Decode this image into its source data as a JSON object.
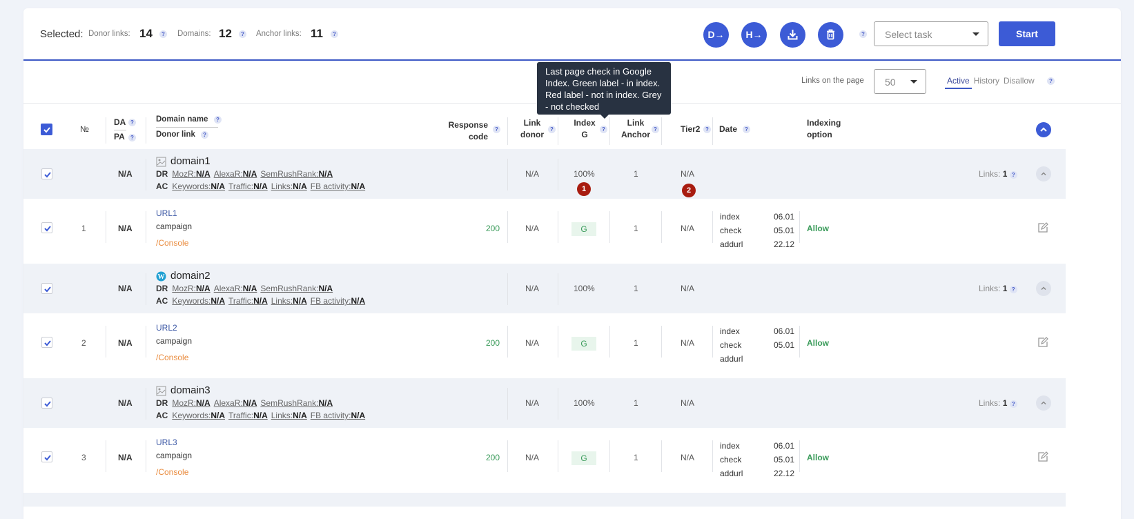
{
  "toolbar": {
    "selected_label": "Selected:",
    "stats": [
      {
        "label": "Donor links:",
        "value": "14"
      },
      {
        "label": "Domains:",
        "value": "12"
      },
      {
        "label": "Anchor links:",
        "value": "11"
      }
    ],
    "action_buttons": [
      {
        "name": "donor-export",
        "glyph": "D→"
      },
      {
        "name": "host-export",
        "glyph": "H→"
      },
      {
        "name": "download",
        "glyph": "download-icon"
      },
      {
        "name": "delete",
        "glyph": "trash-icon"
      }
    ],
    "task_select_placeholder": "Select task",
    "start_label": "Start"
  },
  "subbar": {
    "links_on_page_label": "Links on the page",
    "links_on_page_value": "50",
    "tabs": [
      {
        "label": "Active",
        "active": true
      },
      {
        "label": "History",
        "active": false
      },
      {
        "label": "Disallow",
        "active": false
      }
    ]
  },
  "tooltip": {
    "text": "Last page check in Google Index. Green label - in index. Red label - not in index. Grey - not checked"
  },
  "columns": {
    "num": "№",
    "da": "DA",
    "pa": "PA",
    "domain_name": "Domain name",
    "donor_link": "Donor link",
    "response_code_1": "Response",
    "response_code_2": "code",
    "link_donor_1": "Link",
    "link_donor_2": "donor",
    "index_g_1": "Index",
    "index_g_2": "G",
    "link_anchor_1": "Link",
    "link_anchor_2": "Anchor",
    "tier2": "Tier2",
    "date": "Date",
    "indexing_option_1": "Indexing",
    "indexing_option_2": "option"
  },
  "groups": [
    {
      "domain": "domain1",
      "favicon": "image-placeholder-icon",
      "da": "N/A",
      "dr_key": "DR",
      "ac_key": "AC",
      "dr_metrics": [
        {
          "label": "MozR:",
          "value": "N/A"
        },
        {
          "label": "AlexaR:",
          "value": "N/A"
        },
        {
          "label": "SemRushRank:",
          "value": "N/A"
        }
      ],
      "ac_metrics": [
        {
          "label": "Keywords:",
          "value": "N/A"
        },
        {
          "label": "Traffic:",
          "value": "N/A"
        },
        {
          "label": "Links:",
          "value": "N/A"
        },
        {
          "label": "FB activity:",
          "value": "N/A"
        }
      ],
      "link_donor": "N/A",
      "index_g": "100%",
      "link_anchor": "1",
      "tier2": "N/A",
      "links_label": "Links:",
      "links_count": "1",
      "badges": {
        "index": "1",
        "tier2": "2"
      },
      "link": {
        "num": "1",
        "pa": "N/A",
        "url": "URL1",
        "campaign": "campaign",
        "console": "/Console",
        "response_code": "200",
        "link_donor": "N/A",
        "index_g": "G",
        "link_anchor": "1",
        "tier2": "N/A",
        "dates": [
          {
            "label": "index",
            "value": "06.01"
          },
          {
            "label": "check",
            "value": "05.01"
          },
          {
            "label": "addurl",
            "value": "22.12"
          }
        ],
        "indexing_option": "Allow"
      }
    },
    {
      "domain": "domain2",
      "favicon": "wordpress-icon",
      "da": "N/A",
      "dr_key": "DR",
      "ac_key": "AC",
      "dr_metrics": [
        {
          "label": "MozR:",
          "value": "N/A"
        },
        {
          "label": "AlexaR:",
          "value": "N/A"
        },
        {
          "label": "SemRushRank:",
          "value": "N/A"
        }
      ],
      "ac_metrics": [
        {
          "label": "Keywords:",
          "value": "N/A"
        },
        {
          "label": "Traffic:",
          "value": "N/A"
        },
        {
          "label": "Links:",
          "value": "N/A"
        },
        {
          "label": "FB activity:",
          "value": "N/A"
        }
      ],
      "link_donor": "N/A",
      "index_g": "100%",
      "link_anchor": "1",
      "tier2": "N/A",
      "links_label": "Links:",
      "links_count": "1",
      "link": {
        "num": "2",
        "pa": "N/A",
        "url": "URL2",
        "campaign": "campaign",
        "console": "/Console",
        "response_code": "200",
        "link_donor": "N/A",
        "index_g": "G",
        "link_anchor": "1",
        "tier2": "N/A",
        "dates": [
          {
            "label": "index",
            "value": "06.01"
          },
          {
            "label": "check",
            "value": "05.01"
          },
          {
            "label": "addurl",
            "value": ""
          }
        ],
        "indexing_option": "Allow"
      }
    },
    {
      "domain": "domain3",
      "favicon": "image-placeholder-icon",
      "da": "N/A",
      "dr_key": "DR",
      "ac_key": "AC",
      "dr_metrics": [
        {
          "label": "MozR:",
          "value": "N/A"
        },
        {
          "label": "AlexaR:",
          "value": "N/A"
        },
        {
          "label": "SemRushRank:",
          "value": "N/A"
        }
      ],
      "ac_metrics": [
        {
          "label": "Keywords:",
          "value": "N/A"
        },
        {
          "label": "Traffic:",
          "value": "N/A"
        },
        {
          "label": "Links:",
          "value": "N/A"
        },
        {
          "label": "FB activity:",
          "value": "N/A"
        }
      ],
      "link_donor": "N/A",
      "index_g": "100%",
      "link_anchor": "1",
      "tier2": "N/A",
      "links_label": "Links:",
      "links_count": "1",
      "link": {
        "num": "3",
        "pa": "N/A",
        "url": "URL3",
        "campaign": "campaign",
        "console": "/Console",
        "response_code": "200",
        "link_donor": "N/A",
        "index_g": "G",
        "link_anchor": "1",
        "tier2": "N/A",
        "dates": [
          {
            "label": "index",
            "value": "06.01"
          },
          {
            "label": "check",
            "value": "05.01"
          },
          {
            "label": "addurl",
            "value": "22.12"
          }
        ],
        "indexing_option": "Allow"
      }
    }
  ],
  "help_glyph": "?"
}
